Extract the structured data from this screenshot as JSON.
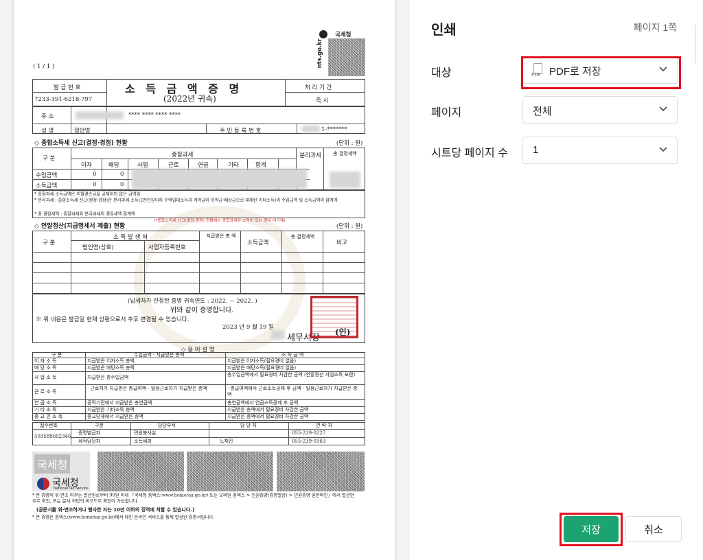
{
  "dialog": {
    "title": "인쇄",
    "page_count": "페이지 1쪽",
    "destination": {
      "label": "대상",
      "value": "PDF로 저장",
      "icon_text": "PDF"
    },
    "pages": {
      "label": "페이지",
      "value": "전체"
    },
    "pages_per_sheet": {
      "label": "시트당 페이지 수",
      "value": "1"
    },
    "save_button": "저장",
    "cancel_button": "취소",
    "highlight_color": "#e3101f",
    "save_color": "#1ba371"
  },
  "document": {
    "page_number": "( 1 / 1 )",
    "site": "nts.go.kr",
    "agency_top": "국세청",
    "issue_no_label": "발 급 번 호",
    "issue_no": "7233-391-6218-797",
    "title": "소 득 금 액 증 명",
    "subtitle": "(2022년 귀속)",
    "processing_label": "처 리 기 간",
    "processing_value": "즉 시",
    "address_label": "주 소",
    "address_value": "**** **** **** ****",
    "name_label": "성 명",
    "name_value": "정만영",
    "rrn_label": "주 민 등 록 번 호",
    "rrn_value": "1-*******",
    "section1_title": "◇ 종합소득세 신고(결정·경정) 현황",
    "unit": "(단위 : 원)",
    "col_category": "구 분",
    "col_comprehensive": "종합과세",
    "cols": [
      "이자",
      "배당",
      "사업",
      "근로",
      "연금",
      "기타",
      "합계"
    ],
    "col_separate": "분리과세",
    "col_total": "총 결정세액",
    "row_income": "수입금액",
    "row_earned": "소득금액",
    "zero": "0",
    "note1": "* 종합과세 소득금액은 이월결손금을 공제하지 않은 금액임",
    "note2": "* 분리과세 : 종합소득세 신고(결정·경정)한 분리과세 소득(2천만원이하 주택임대소득과 계약금이 위약금·배상금으로 대체된 기타소득)의 수입금액 및 소득금액의 합계액",
    "note3": "* 총 결정세액 : 종합과세와 분리과세의 결정세액 합계액",
    "section2_title": "◇ 연말정산(지급명세서 제출) 현황",
    "section2_note": "(*종합소득세 신고(결정,경정) 현황에서 종합과세된 소득이 있는 경우 미기재)",
    "col_source": "소 득 발 생 처",
    "col_corp": "법인명(상호)",
    "col_bizno": "사업자등록번호",
    "col_paid": "지급받은 총 액",
    "col_income_amt": "소득금액",
    "col_final_tax": "총 결정세액",
    "col_remark": "비고",
    "year_range": "(납세자가 신청한 증명 귀속연도 : 2022. ~ 2022. )",
    "certify": "위와 같이 증명합니다.",
    "warn": "※ 위 내용은 발급일 현재 상황으로서 추후 변경될 수 있습니다.",
    "date": "2023 년  9 월  19 일",
    "office": "세무서장",
    "seal_mark": "(인)",
    "usage_title": "◇ 용 어 설 명",
    "usage_col1": "구 분",
    "usage_col2": "수입금액 · 지급받은 총액",
    "usage_col3": "소 득 금 액",
    "usage_rows": [
      [
        "이 자 소 득",
        "지급받은 이자소득 총액",
        "지급받은 이자소득(필요경비 없음)"
      ],
      [
        "배 당 소 득",
        "지급받은 배당소득 총액",
        "지급받은 배당소득(필요경비 없음)"
      ],
      [
        "사 업 소 득",
        "지급받은 총수입금액",
        "총수입금액에서 필요경비 차감한 금액 (연말정산 사업소득 포함)"
      ],
      [
        "근 로 소 득",
        "· 근로자가 지급받은 총급여액 · 일용근로자가 지급받은 총액",
        "· 총급여액에서 근로소득공제 후 금액 · 일용근로자가 지급받은 총액"
      ],
      [
        "연 금 소 득",
        "공적기관에서 지급받은 총연금액",
        "총연금액에서 연금소득공제 후 금액"
      ],
      [
        "기 타 소 득",
        "지급받은 기타소득 총액",
        "지급받은 총액에서 필요경비 차감한 금액"
      ],
      [
        "종 교 인 소 득",
        "종교단체에서 지급받은 총액",
        "지급받은 총액에서 필요경비 차감한 금액"
      ]
    ],
    "footer_cols": [
      "접수번호",
      "구분",
      "담당부서",
      "담 당 자",
      "연 락 처"
    ],
    "receipt_no": "503589692346",
    "footer_rows": [
      [
        "증명발급자",
        "민원봉사실",
        "",
        "055-239-0227"
      ],
      [
        "세적담당자",
        "소득세과",
        "노재진",
        "055-239-0363"
      ]
    ],
    "nts_badge": "국세청",
    "nts_logo": "국세청",
    "nts_logo_en": "National Tax Service",
    "foot1": "* 본 증명의 위·변조 여부는 발급일로부터 90일 이내 「국세청 홈택스(www.hometax.go.kr) 또는 모바일 홈택스 > 민원증명(증명발급) > 민원증명 원본확인」에서 발급번호로 확인, 또는 문서 하단의 바코드로 확인이 가능합니다.",
    "foot2": "(공문서를 위·변조하거나 행사한 자는 10년 이하의 징역에 처할 수 있습니다.)",
    "foot3": "* 본 증명은 홈택스(www.hometax.go.kr)에서 대민 온라인 서비스를 통해 발급된 증명서입니다."
  }
}
